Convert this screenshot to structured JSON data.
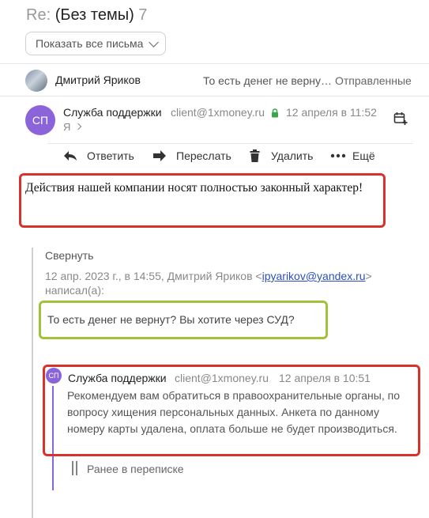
{
  "header": {
    "re": "Re:",
    "subject": "(Без темы)",
    "count": "7",
    "show_all_label": "Показать все письма"
  },
  "collapsed_message": {
    "sender": "Дмитрий Яриков",
    "snippet": "То есть денег не верну…",
    "folder": "Отправленные"
  },
  "message": {
    "avatar_initials": "СП",
    "sender": "Служба поддержки",
    "email": "client@1xmoney.ru",
    "date": "12 апреля в 11:52",
    "to": "Я",
    "body": "Действия нашей компании носят полностью законный характер!"
  },
  "toolbar": {
    "reply": "Ответить",
    "forward": "Переслать",
    "delete": "Удалить",
    "more": "Ещё"
  },
  "quote": {
    "collapse": "Свернуть",
    "header_before": "12 апр. 2023 г., в 14:55, Дмитрий Яриков <",
    "header_email": "ipyarikov@yandex.ru",
    "header_after": ">",
    "header_wrote": "написал(а):",
    "question": "То есть денег не вернут? Вы хотите через СУД?"
  },
  "inner_quote": {
    "avatar_initials": "СП",
    "sender": "Служба поддержки",
    "email": "client@1xmoney.ru",
    "date": "12 апреля в 10:51",
    "body": "Рекомендуем вам обратиться в правоохранительные органы, по вопросу хищения персональных данных. Анкета по данному номеру карты удалена, оплата больше не будет производиться."
  },
  "earlier": "Ранее в переписке",
  "colors": {
    "accent_purple": "#8a64d8",
    "highlight_red": "#d8322d",
    "highlight_green": "#a1c23a",
    "link_blue": "#2c4fbf",
    "lock_green": "#3aa74a"
  }
}
